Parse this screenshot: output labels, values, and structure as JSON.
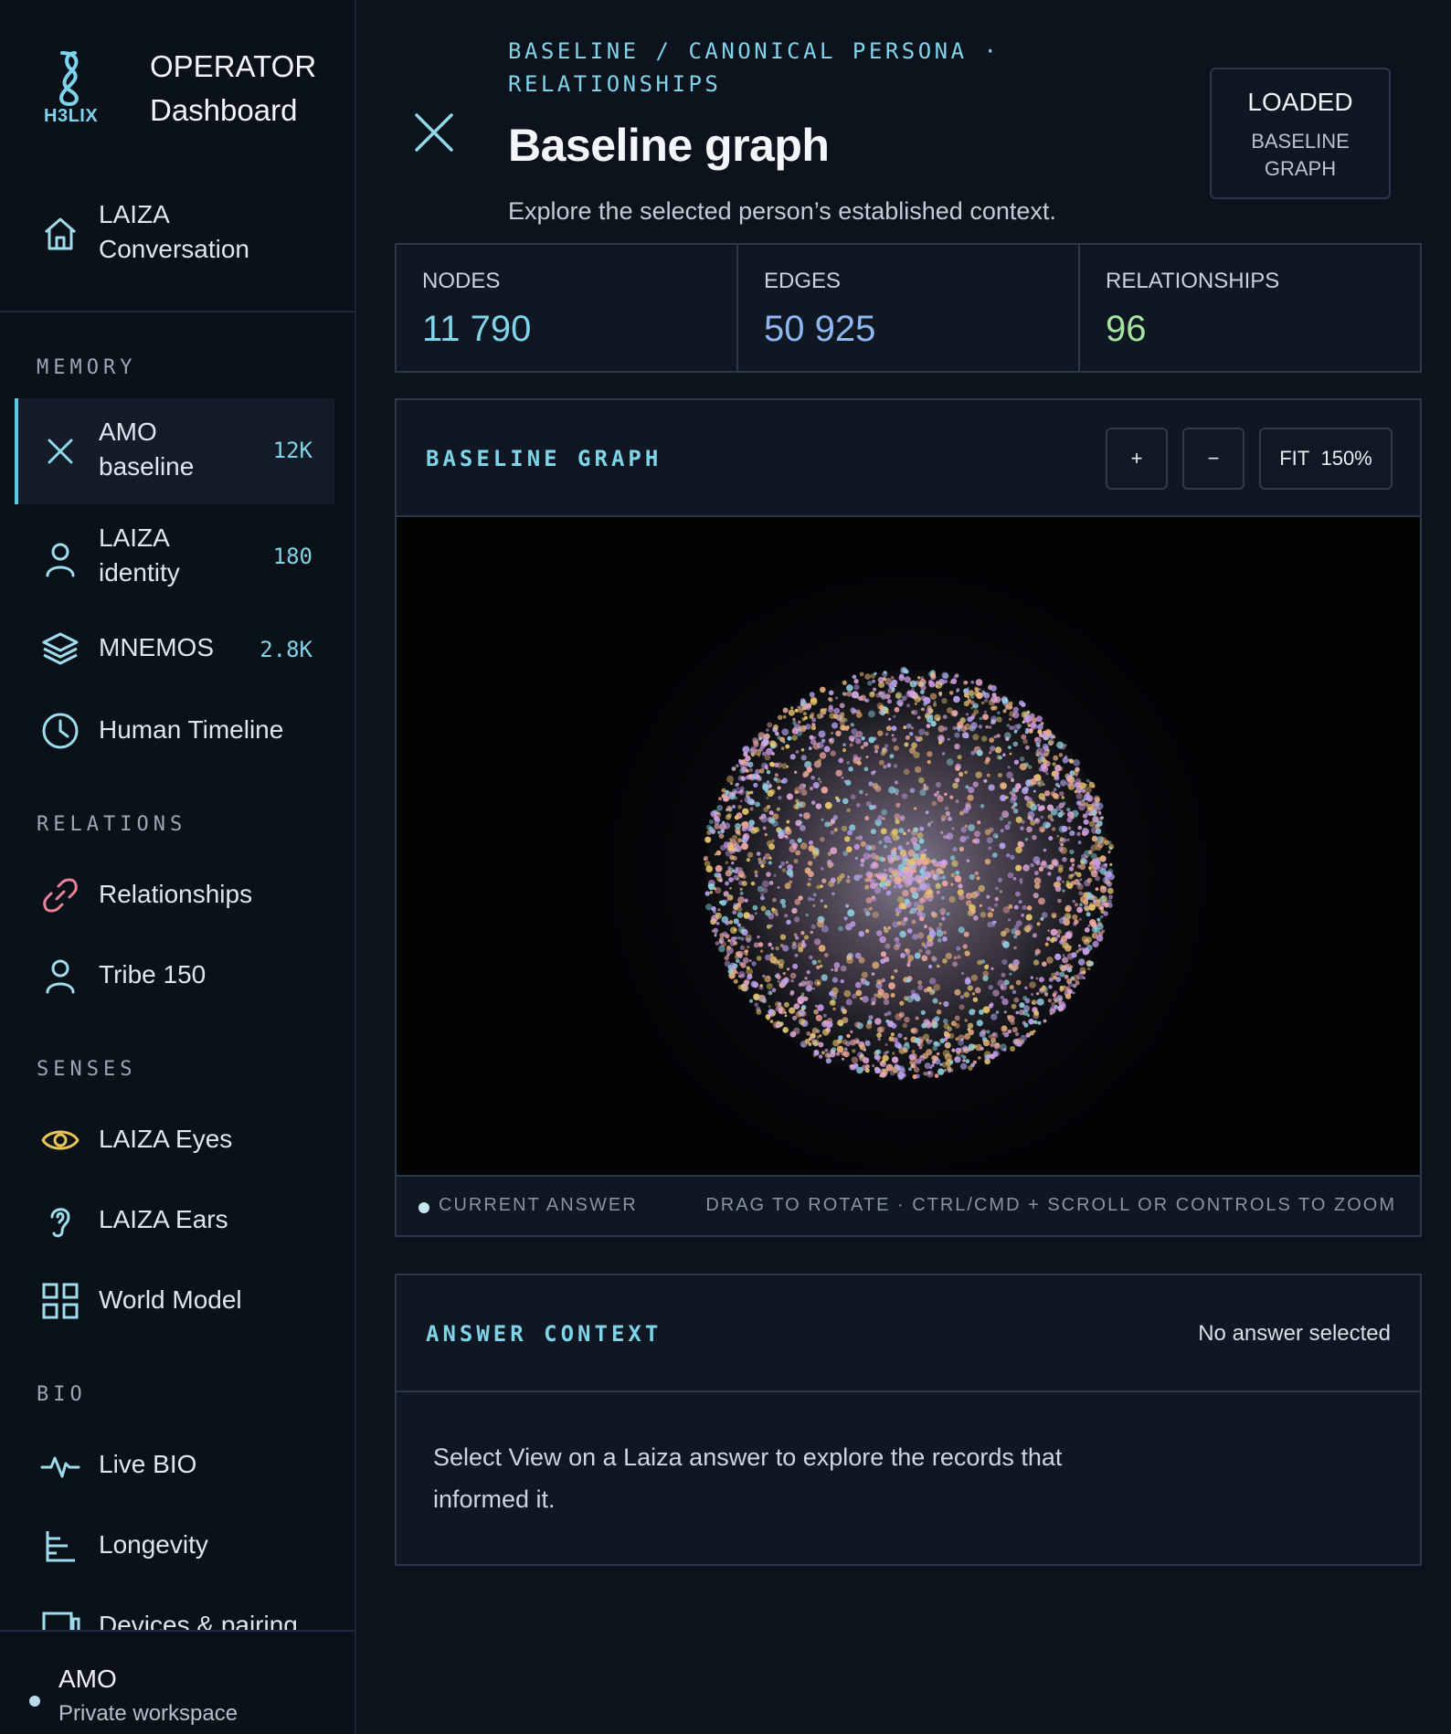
{
  "brand": {
    "logo_text": "H3LIX",
    "title": "OPERATOR",
    "subtitle": "Dashboard"
  },
  "sidebar": {
    "top_item": {
      "line1": "LAIZA",
      "line2": "Conversation",
      "icon": "home-icon"
    },
    "sections": {
      "memory": "MEMORY",
      "relations": "RELATIONS",
      "senses": "SENSES",
      "bio": "BIO"
    },
    "memory_items": [
      {
        "line1": "AMO",
        "line2": "baseline",
        "count": "12K",
        "icon": "close-icon",
        "active": true
      },
      {
        "line1": "LAIZA",
        "line2": "identity",
        "count": "180",
        "icon": "user-icon"
      },
      {
        "label": "MNEMOS",
        "count": "2.8K",
        "icon": "layers-icon"
      },
      {
        "label": "Human Timeline",
        "icon": "clock-icon"
      }
    ],
    "relations_items": [
      {
        "label": "Relationships",
        "icon": "link-icon"
      },
      {
        "label": "Tribe 150",
        "icon": "user-icon"
      }
    ],
    "senses_items": [
      {
        "label": "LAIZA Eyes",
        "icon": "eye-icon"
      },
      {
        "label": "LAIZA Ears",
        "icon": "ear-icon"
      },
      {
        "label": "World Model",
        "icon": "grid-icon"
      }
    ],
    "bio_items": [
      {
        "label": "Live BIO",
        "icon": "pulse-icon"
      },
      {
        "label": "Longevity",
        "icon": "bars-icon"
      },
      {
        "label": "Devices & pairing",
        "icon": "device-icon"
      }
    ],
    "user": {
      "name": "AMO",
      "workspace": "Private workspace"
    }
  },
  "header": {
    "breadcrumb": "BASELINE / CANONICAL PERSONA · RELATIONSHIPS",
    "title": "Baseline graph",
    "description": "Explore the selected person’s established context.",
    "badge": {
      "status": "LOADED",
      "detail": "BASELINE GRAPH"
    }
  },
  "stats": [
    {
      "label": "NODES",
      "value": "11 790",
      "color": "#7fd4ea"
    },
    {
      "label": "EDGES",
      "value": "50 925",
      "color": "#8fb8f2"
    },
    {
      "label": "RELATIONSHIPS",
      "value": "96",
      "color": "#a6e3a1"
    }
  ],
  "graph": {
    "title": "BASELINE GRAPH",
    "zoom_in": "+",
    "zoom_out": "−",
    "fit_label": "FIT",
    "zoom_level": "150%",
    "footer_left": "CURRENT ANSWER",
    "footer_right": "DRAG TO ROTATE · CTRL/CMD + SCROLL OR CONTROLS TO ZOOM",
    "node_palette": [
      "#c89be8",
      "#e0a7d6",
      "#e8b07a",
      "#e8c86e",
      "#8ed0e0",
      "#f0a8a0",
      "#b7a4f0"
    ]
  },
  "answer": {
    "title": "ANSWER CONTEXT",
    "status": "No answer selected",
    "body": "Select View on a Laiza answer to explore the records that informed it."
  }
}
